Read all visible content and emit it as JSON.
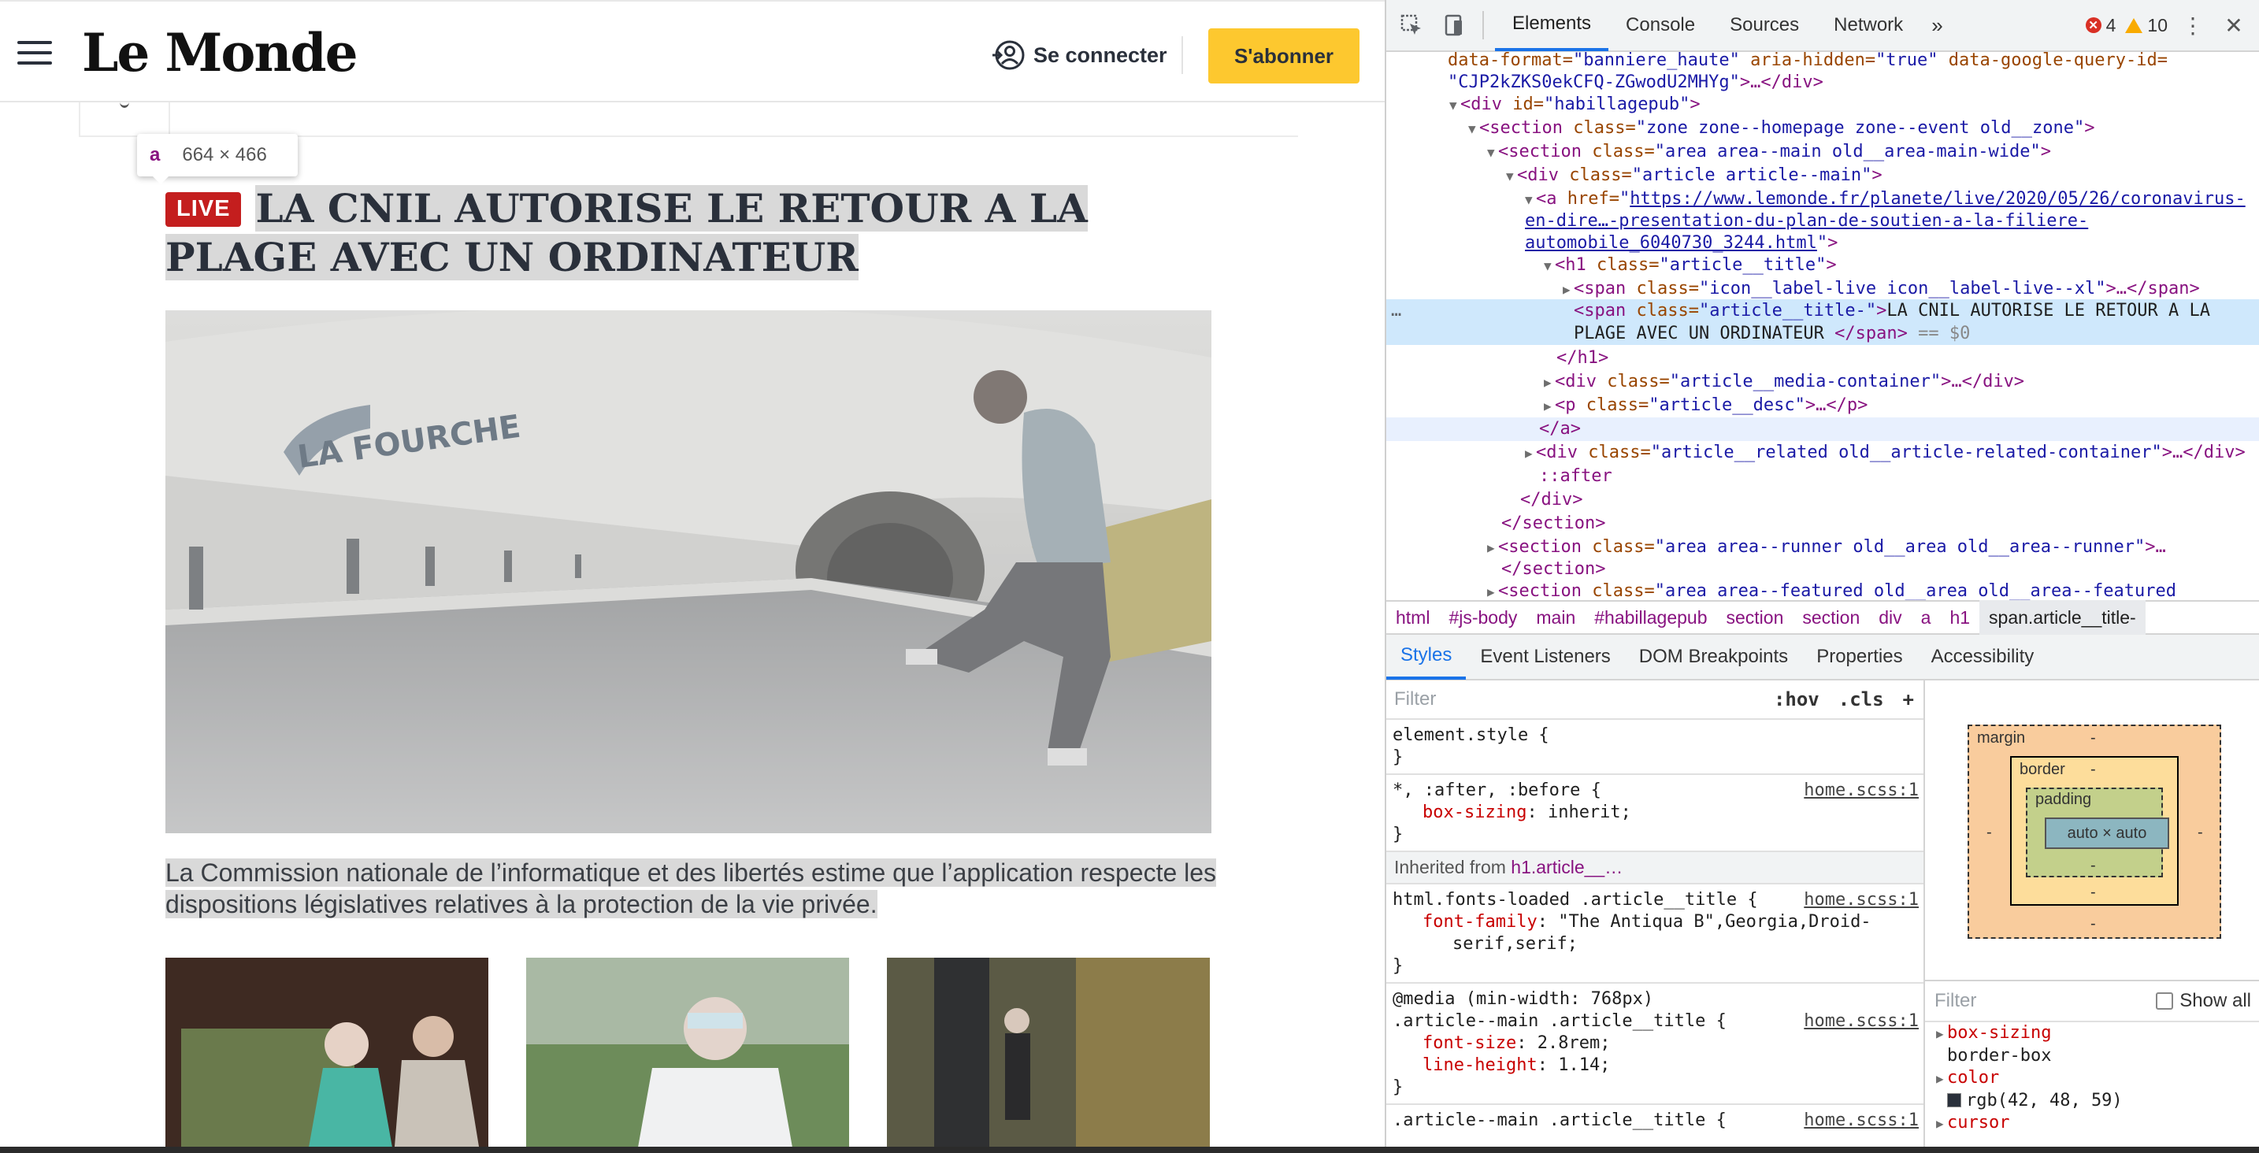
{
  "page": {
    "logo": "Le Monde",
    "login_label": "Se connecter",
    "subscribe_label": "S'abonner",
    "inspect_tooltip": {
      "tag": "a",
      "dims": "664 × 466"
    },
    "live_badge": "LIVE",
    "headline": "LA CNIL AUTORISE LE RETOUR A LA PLAGE AVEC UN ORDINATEUR",
    "description": "La Commission nationale de l’informatique et des libertés estime que l’application respecte les dispositions législatives relatives à la protection de la vie privée."
  },
  "devtools": {
    "tabs": [
      "Elements",
      "Console",
      "Sources",
      "Network"
    ],
    "more_tabs": "»",
    "errors": "4",
    "warnings": "10",
    "dom": {
      "l0_a": "data-format=",
      "l0_b": "\"banniere_haute\"",
      "l0_c": " aria-hidden=",
      "l0_d": "\"true\"",
      "l0_e": " data-google-query-id=",
      "l1": "\"CJP2kZKS0ekCFQ-ZGwodU2MHYg\"",
      "l1_tail": ">…</div>",
      "l2_tag": "<div ",
      "l2_attr": "id=",
      "l2_val": "\"habillagepub\"",
      "l3_val": "\"zone zone--homepage zone--event old__zone\"",
      "l4_val": "\"area area--main old__area-main-wide\"",
      "l5_val": "\"article article--main\"",
      "l6_href1": "https://www.lemonde.fr/planete/live/2020/05/26/coronavirus-",
      "l6_href2": "en-dire…-presentation-du-plan-de-soutien-a-la-filiere-",
      "l6_href3": "automobile_6040730_3244.html",
      "l7_val": "\"article__title\"",
      "l8_val": "\"icon__label-live icon__label-live--xl\"",
      "l9_val": "\"article__title-\"",
      "l9_text1": "LA CNIL AUTORISE LE RETOUR A LA",
      "l9_text2": "PLAGE AVEC UN ORDINATEUR ",
      "l9_eq": " == $0",
      "l11_val": "\"article__media-container\"",
      "l12_val": "\"article__desc\"",
      "l14_val": "\"article__related old__article-related-container\"",
      "l15": "::after",
      "l18_val": "\"area area--runner old__area old__area--runner\"",
      "l20_val": "\"area area--featured old__area old__area--featured"
    },
    "breadcrumbs": [
      "html",
      "#js-body",
      "main",
      "#habillagepub",
      "section",
      "section",
      "div",
      "a",
      "h1",
      "span.article__title-"
    ],
    "subtabs": [
      "Styles",
      "Event Listeners",
      "DOM Breakpoints",
      "Properties",
      "Accessibility"
    ],
    "styles_filter_placeholder": "Filter",
    "hov": ":hov",
    "cls": ".cls",
    "add": "+",
    "rules": {
      "r1_sel": "element.style {",
      "r2_sel": "*, :after, :before {",
      "r2_src": "home.scss:1",
      "r2_prop": "box-sizing",
      "r2_val": "inherit;",
      "inherited_prefix": "Inherited from ",
      "inherited_sel": "h1.article__…",
      "r3_sel": "html.fonts-loaded .article__title {",
      "r3_src": "home.scss:1",
      "r3_prop": "font-family",
      "r3_val1": "\"The Antiqua B\",Georgia,Droid-",
      "r3_val2": "serif,serif;",
      "r4_media": "@media (min-width: 768px)",
      "r4_sel": ".article--main .article__title {",
      "r4_src": "home.scss:1",
      "r4_prop1": "font-size",
      "r4_val1": "2.8rem;",
      "r4_prop2": "line-height",
      "r4_val2": "1.14;",
      "r5_sel": ".article--main .article__title {",
      "r5_src": "home.scss:1",
      "close_brace": "}"
    },
    "boxmodel": {
      "margin": "margin",
      "border": "border",
      "padding": "padding",
      "content": "auto × auto",
      "dash": "-"
    },
    "computed": {
      "filter_placeholder": "Filter",
      "show_all": "Show all",
      "p1_name": "box-sizing",
      "p1_val": "border-box",
      "p2_name": "color",
      "p2_val": "rgb(42, 48, 59)",
      "p3_name": "cursor"
    }
  }
}
